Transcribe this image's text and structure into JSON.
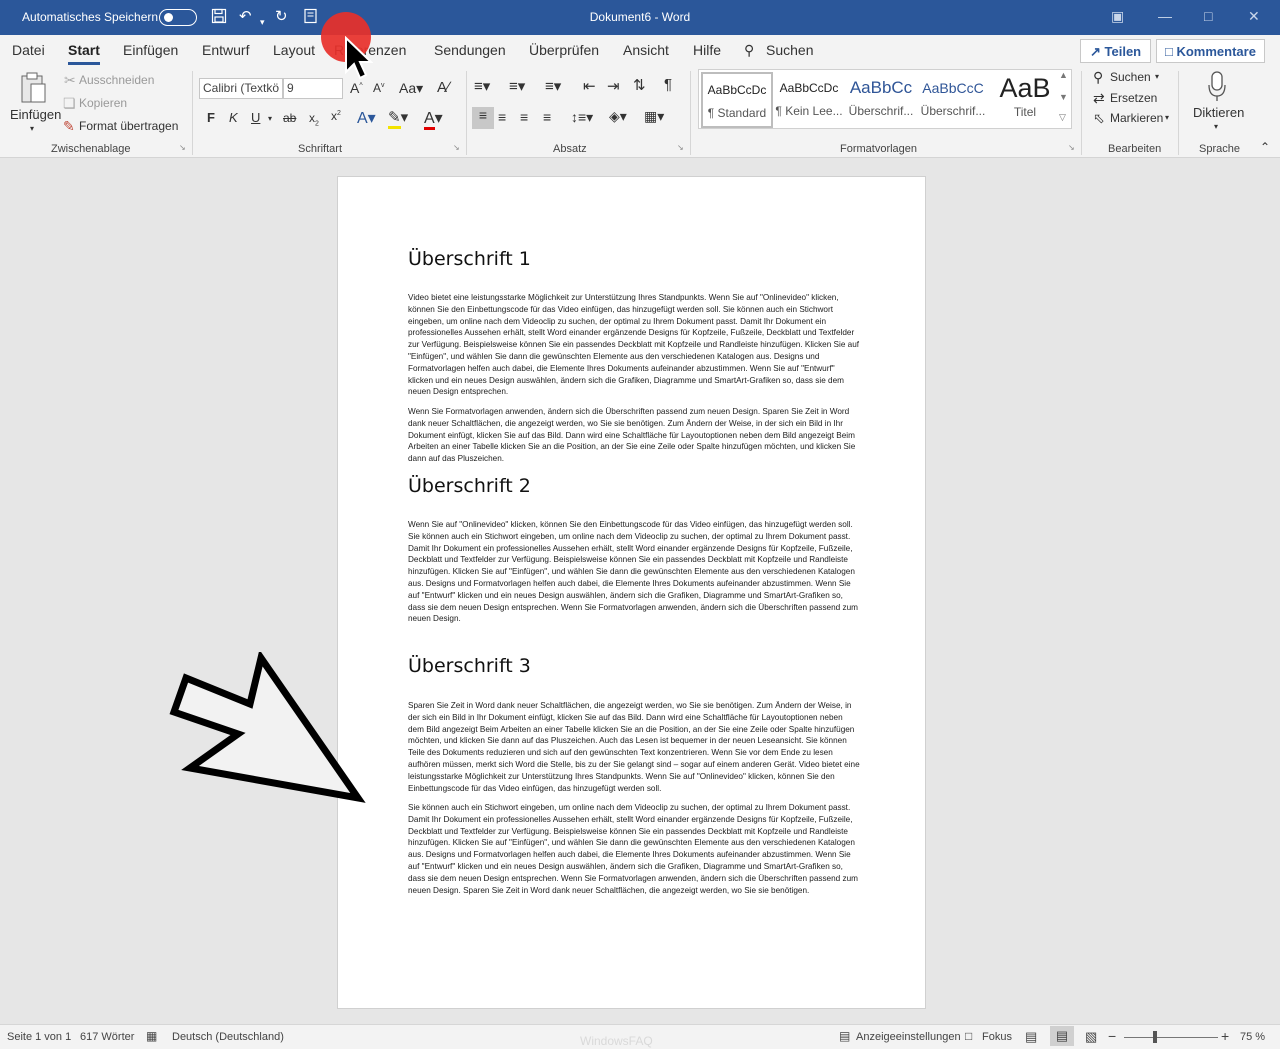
{
  "title_bar": {
    "autosave_label": "Automatisches Speichern",
    "document_title": "Dokument6 - Word"
  },
  "tabs": [
    {
      "label": "Datei"
    },
    {
      "label": "Start",
      "active": true
    },
    {
      "label": "Einfügen"
    },
    {
      "label": "Entwurf"
    },
    {
      "label": "Layout"
    },
    {
      "label": "Referenzen"
    },
    {
      "label": "Sendungen"
    },
    {
      "label": "Überprüfen"
    },
    {
      "label": "Ansicht"
    },
    {
      "label": "Hilfe"
    },
    {
      "label": "Suchen"
    }
  ],
  "share_label": "Teilen",
  "comments_label": "Kommentare",
  "ribbon": {
    "clipboard": {
      "paste_label": "Einfügen",
      "cut_label": "Ausschneiden",
      "copy_label": "Kopieren",
      "format_painter_label": "Format übertragen",
      "group_label": "Zwischenablage"
    },
    "font": {
      "font_name": "Calibri (Textkö",
      "font_size": "9",
      "bold": "F",
      "italic": "K",
      "underline": "U",
      "group_label": "Schriftart"
    },
    "paragraph": {
      "group_label": "Absatz"
    },
    "styles": {
      "items": [
        {
          "preview": "AaBbCcDc",
          "name": "¶ Standard"
        },
        {
          "preview": "AaBbCcDc",
          "name": "¶ Kein Lee..."
        },
        {
          "preview": "AaBbCc",
          "name": "Überschrif..."
        },
        {
          "preview": "AaBbCcC",
          "name": "Überschrif..."
        },
        {
          "preview": "AaB",
          "name": "Titel"
        }
      ],
      "group_label": "Formatvorlagen"
    },
    "editing": {
      "find_label": "Suchen",
      "replace_label": "Ersetzen",
      "select_label": "Markieren",
      "group_label": "Bearbeiten"
    },
    "voice": {
      "dictate_label": "Diktieren",
      "group_label": "Sprache"
    }
  },
  "document": {
    "heading1": "Überschrift 1",
    "para1": "Video bietet eine leistungsstarke Möglichkeit zur Unterstützung Ihres Standpunkts. Wenn Sie auf \"Onlinevideo\" klicken, können Sie den Einbettungscode für das Video einfügen, das hinzugefügt werden soll. Sie können auch ein Stichwort eingeben, um online nach dem Videoclip zu suchen, der optimal zu Ihrem Dokument passt. Damit Ihr Dokument ein professionelles Aussehen erhält, stellt Word einander ergänzende Designs für Kopfzeile, Fußzeile, Deckblatt und Textfelder zur Verfügung. Beispielsweise können Sie ein passendes Deckblatt mit Kopfzeile und Randleiste hinzufügen. Klicken Sie auf \"Einfügen\", und wählen Sie dann die gewünschten Elemente aus den verschiedenen Katalogen aus. Designs und Formatvorlagen helfen auch dabei, die Elemente Ihres Dokuments aufeinander abzustimmen. Wenn Sie auf \"Entwurf\" klicken und ein neues Design auswählen, ändern sich die Grafiken, Diagramme und SmartArt-Grafiken so, dass sie dem neuen Design entsprechen.",
    "para2": "Wenn Sie Formatvorlagen anwenden, ändern sich die Überschriften passend zum neuen Design. Sparen Sie Zeit in Word dank neuer Schaltflächen, die angezeigt werden, wo Sie sie benötigen. Zum Ändern der Weise, in der sich ein Bild in Ihr Dokument einfügt, klicken Sie auf das Bild. Dann wird eine Schaltfläche für Layoutoptionen neben dem Bild angezeigt Beim Arbeiten an einer Tabelle klicken Sie an die Position, an der Sie eine Zeile oder Spalte hinzufügen möchten, und klicken Sie dann auf das Pluszeichen.",
    "heading2": "Überschrift 2",
    "para3": "Wenn Sie auf \"Onlinevideo\" klicken, können Sie den Einbettungscode für das Video einfügen, das hinzugefügt werden soll. Sie können auch ein Stichwort eingeben, um online nach dem Videoclip zu suchen, der optimal zu Ihrem Dokument passt. Damit Ihr Dokument ein professionelles Aussehen erhält, stellt Word einander ergänzende Designs für Kopfzeile, Fußzeile, Deckblatt und Textfelder zur Verfügung. Beispielsweise können Sie ein passendes Deckblatt mit Kopfzeile und Randleiste hinzufügen. Klicken Sie auf \"Einfügen\", und wählen Sie dann die gewünschten Elemente aus den verschiedenen Katalogen aus. Designs und Formatvorlagen helfen auch dabei, die Elemente Ihres Dokuments aufeinander abzustimmen. Wenn Sie auf \"Entwurf\" klicken und ein neues Design auswählen, ändern sich die Grafiken, Diagramme und SmartArt-Grafiken so, dass sie dem neuen Design entsprechen. Wenn Sie Formatvorlagen anwenden, ändern sich die Überschriften passend zum neuen Design.",
    "heading3": "Überschrift 3",
    "para4": "Sparen Sie Zeit in Word dank neuer Schaltflächen, die angezeigt werden, wo Sie sie benötigen. Zum Ändern der Weise, in der sich ein Bild in Ihr Dokument einfügt, klicken Sie auf das Bild. Dann wird eine Schaltfläche für Layoutoptionen neben dem Bild angezeigt Beim Arbeiten an einer Tabelle klicken Sie an die Position, an der Sie eine Zeile oder Spalte hinzufügen möchten, und klicken Sie dann auf das Pluszeichen. Auch das Lesen ist bequemer in der neuen Leseansicht. Sie können Teile des Dokuments reduzieren und sich auf den gewünschten Text konzentrieren. Wenn Sie vor dem Ende zu lesen aufhören müssen, merkt sich Word die Stelle, bis zu der Sie gelangt sind – sogar auf einem anderen Gerät. Video bietet eine leistungsstarke Möglichkeit zur Unterstützung Ihres Standpunkts. Wenn Sie auf \"Onlinevideo\" klicken, können Sie den Einbettungscode für das Video einfügen, das hinzugefügt werden soll.",
    "para5": "Sie können auch ein Stichwort eingeben, um online nach dem Videoclip zu suchen, der optimal zu Ihrem Dokument passt. Damit Ihr Dokument ein professionelles Aussehen erhält, stellt Word einander ergänzende Designs für Kopfzeile, Fußzeile, Deckblatt und Textfelder zur Verfügung. Beispielsweise können Sie ein passendes Deckblatt mit Kopfzeile und Randleiste hinzufügen. Klicken Sie auf \"Einfügen\", und wählen Sie dann die gewünschten Elemente aus den verschiedenen Katalogen aus. Designs und Formatvorlagen helfen auch dabei, die Elemente Ihres Dokuments aufeinander abzustimmen. Wenn Sie auf \"Entwurf\" klicken und ein neues Design auswählen, ändern sich die Grafiken, Diagramme und SmartArt-Grafiken so, dass sie dem neuen Design entsprechen. Wenn Sie Formatvorlagen anwenden, ändern sich die Überschriften passend zum neuen Design. Sparen Sie Zeit in Word dank neuer Schaltflächen, die angezeigt werden, wo Sie sie benötigen."
  },
  "status_bar": {
    "page": "Seite 1 von 1",
    "words": "617 Wörter",
    "language": "Deutsch (Deutschland)",
    "display_settings": "Anzeigeeinstellungen",
    "focus": "Fokus",
    "zoom": "75 %",
    "zoom_fraction": 0.33
  },
  "watermark": "WindowsFAQ",
  "colors": {
    "accent": "#2b579a",
    "highlight_dot": "#e8302a"
  }
}
